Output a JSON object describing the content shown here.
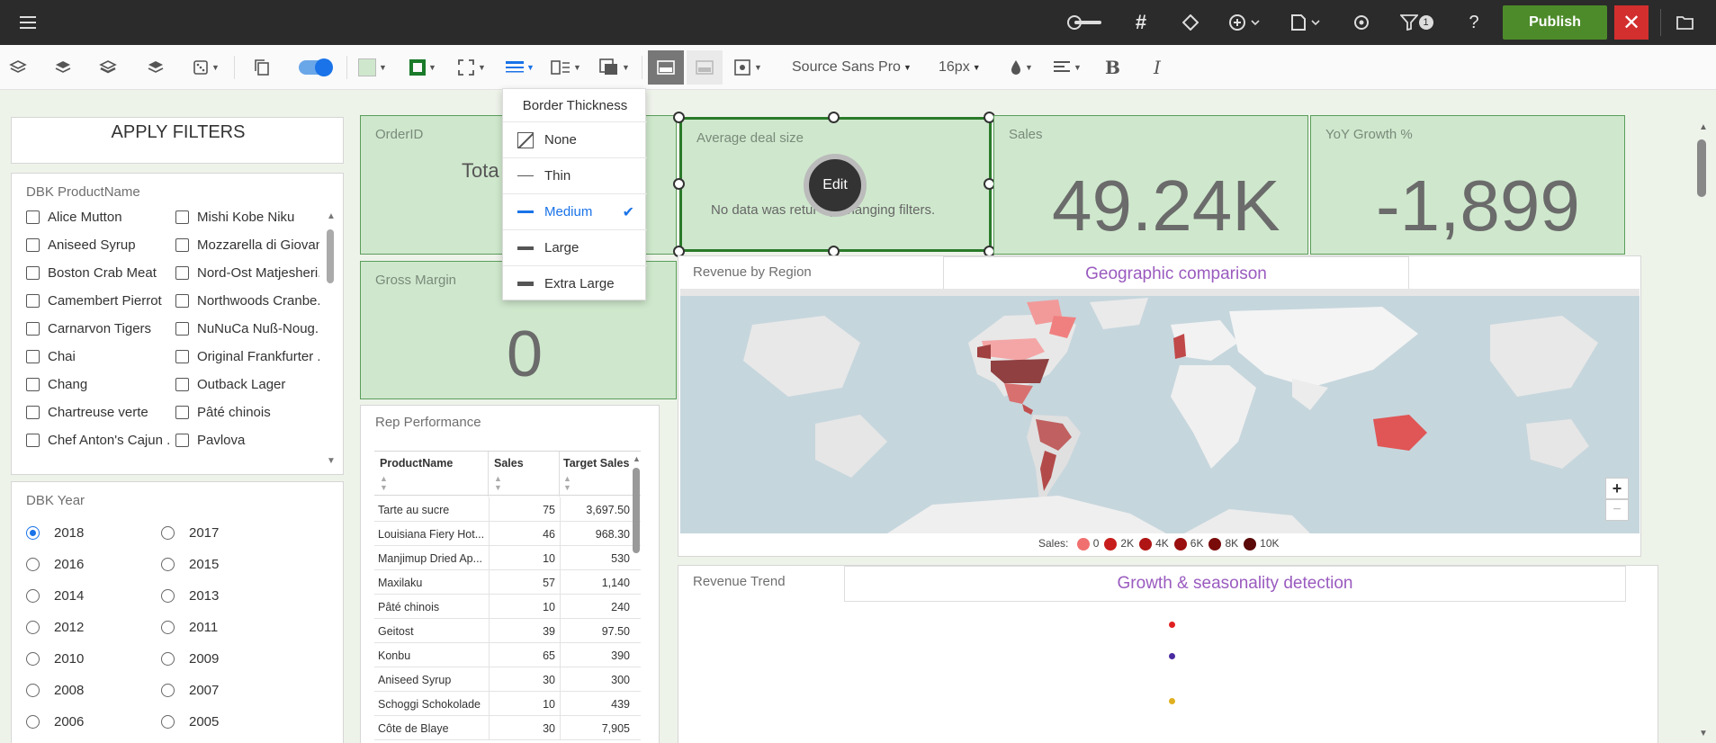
{
  "topbar": {
    "filter_count": "1",
    "publish_label": "Publish"
  },
  "toolbar": {
    "font_family": "Source Sans Pro",
    "font_size": "16px"
  },
  "border_menu": {
    "title": "Border Thickness",
    "items": [
      "None",
      "Thin",
      "Medium",
      "Large",
      "Extra Large"
    ],
    "selected": "Medium"
  },
  "filters": {
    "apply_label": "APPLY FILTERS",
    "product_title": "DBK ProductName",
    "products_col1": [
      "Alice Mutton",
      "Aniseed Syrup",
      "Boston Crab Meat",
      "Camembert Pierrot",
      "Carnarvon Tigers",
      "Chai",
      "Chang",
      "Chartreuse verte",
      "Chef Anton's Cajun ..."
    ],
    "products_col2": [
      "Mishi Kobe Niku",
      "Mozzarella di Giovan",
      "Nord-Ost Matjesheri..",
      "Northwoods Cranbe..",
      "NuNuCa Nuß-Noug..",
      "Original Frankfurter ..",
      "Outback Lager",
      "Pâté chinois",
      "Pavlova"
    ],
    "year_title": "DBK Year",
    "years_col1": [
      "2018",
      "2016",
      "2014",
      "2012",
      "2010",
      "2008",
      "2006"
    ],
    "years_col2": [
      "2017",
      "2015",
      "2013",
      "2011",
      "2009",
      "2007",
      "2005"
    ],
    "selected_year": "2018"
  },
  "kpis": {
    "orderid_title": "OrderID",
    "orderid_partial": "Tota",
    "avg_title": "Average deal size",
    "avg_message": "No data was returned. Try changing filters.",
    "avg_message_visible_a": "No data was retur",
    "avg_message_visible_b": "y changing filters.",
    "edit_label": "Edit",
    "sales_title": "Sales",
    "sales_value": "49.24K",
    "yoy_title": "YoY Growth %",
    "yoy_value": "-1,899",
    "gm_title": "Gross Margin",
    "gm_value": "0"
  },
  "map": {
    "title": "Revenue by Region",
    "subtitle": "Geographic comparison",
    "legend_label": "Sales:",
    "legend": [
      "0",
      "2K",
      "4K",
      "6K",
      "8K",
      "10K"
    ],
    "legend_colors": [
      "#f07070",
      "#c81d1d",
      "#b01515",
      "#9a0f0f",
      "#7a0b0b",
      "#5a0808"
    ],
    "zoom_in": "+",
    "zoom_out": "−"
  },
  "rep": {
    "title": "Rep Performance",
    "columns": [
      "ProductName",
      "Sales",
      "Target Sales"
    ],
    "rows": [
      [
        "Tarte au sucre",
        "75",
        "3,697.50"
      ],
      [
        "Louisiana Fiery Hot...",
        "46",
        "968.30"
      ],
      [
        "Manjimup Dried Ap...",
        "10",
        "530"
      ],
      [
        "Maxilaku",
        "57",
        "1,140"
      ],
      [
        "Pâté chinois",
        "10",
        "240"
      ],
      [
        "Geitost",
        "39",
        "97.50"
      ],
      [
        "Konbu",
        "65",
        "390"
      ],
      [
        "Aniseed Syrup",
        "30",
        "300"
      ],
      [
        "Schoggi Schokolade",
        "10",
        "439"
      ],
      [
        "Côte de Blaye",
        "30",
        "7,905"
      ]
    ]
  },
  "trend": {
    "title": "Revenue Trend",
    "subtitle": "Growth & seasonality detection",
    "dot_colors": [
      "#e02020",
      "#4a2aa0",
      "#e0b020"
    ]
  }
}
